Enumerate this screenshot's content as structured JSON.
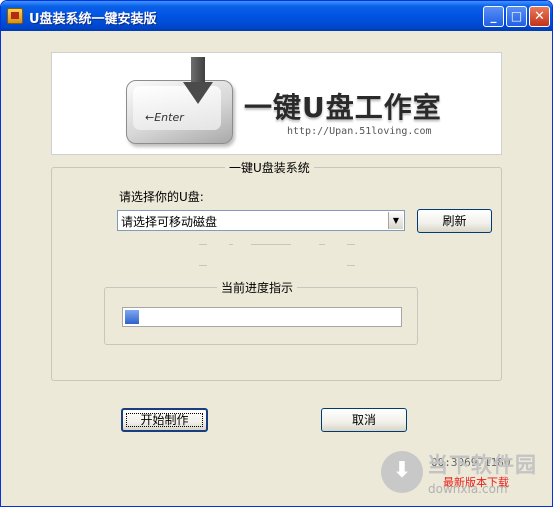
{
  "window": {
    "title": "U盘装系统一键安装版",
    "controls": {
      "minimize": "_",
      "maximize": "□",
      "close": "✕"
    }
  },
  "banner": {
    "key_label": "←Enter",
    "title": "一键U盘工作室",
    "url": "http://Upan.51loving.com"
  },
  "main_group": {
    "legend": "一键U盘装系统",
    "select_label": "请选择你的U盘:",
    "select_value": "请选择可移动磁盘",
    "refresh_button": "刷新"
  },
  "progress": {
    "legend": "当前进度指示",
    "value_percent": 5,
    "fill_color": "#2f62c9"
  },
  "buttons": {
    "start": "开始制作",
    "cancel": "取消"
  },
  "footer": {
    "version_text": "QQ:306971180",
    "watermark_name": "当下软件园",
    "watermark_sub": "最新版本下载",
    "watermark_domain": "downxia.com",
    "watermark_icon": "download-icon"
  },
  "colors": {
    "titlebar": "#0054e3",
    "dialog_bg": "#ece9d8",
    "button_border": "#003c74"
  }
}
